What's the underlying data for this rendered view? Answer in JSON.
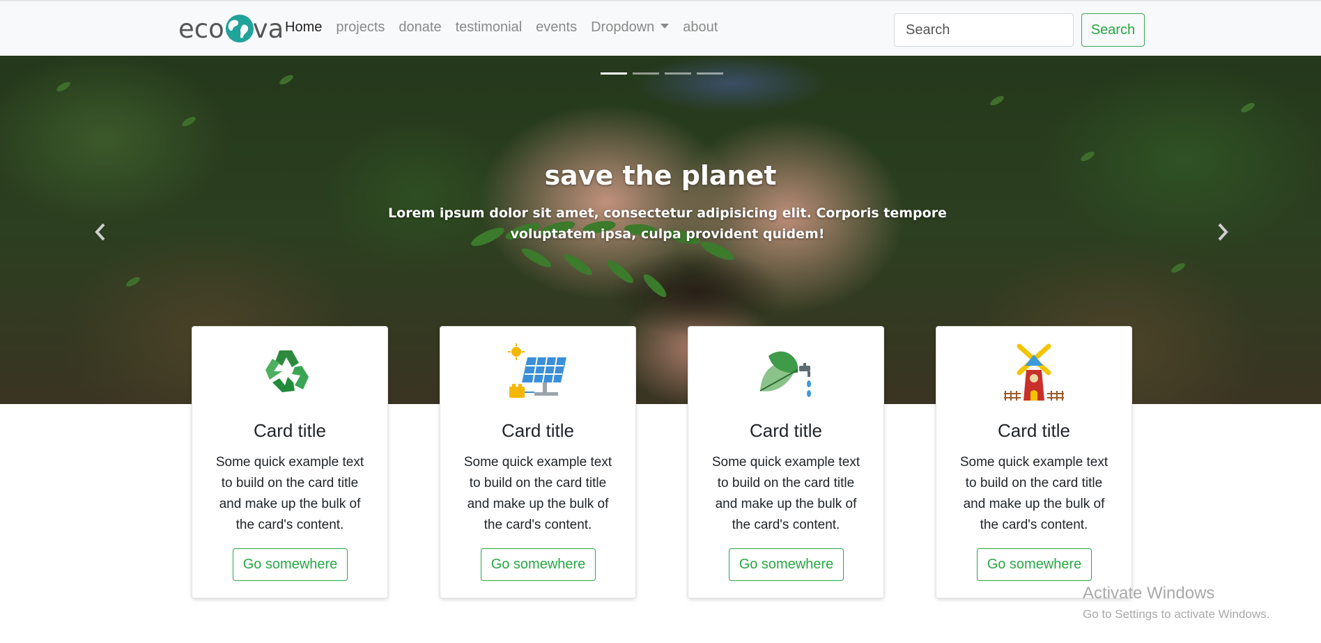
{
  "navbar": {
    "brand": {
      "prefix": "eco",
      "suffix": "va"
    },
    "links": [
      {
        "label": "Home",
        "active": true
      },
      {
        "label": "projects",
        "active": false
      },
      {
        "label": "donate",
        "active": false
      },
      {
        "label": "testimonial",
        "active": false
      },
      {
        "label": "events",
        "active": false
      },
      {
        "label": "Dropdown",
        "active": false
      },
      {
        "label": "about",
        "active": false
      }
    ],
    "search": {
      "placeholder": "Search",
      "button_label": "Search"
    }
  },
  "hero": {
    "title": "save the planet",
    "text": "Lorem ipsum dolor sit amet, consectetur adipisicing elit. Corporis tempore voluptatem ipsa, culpa provident quidem!",
    "indicator_count": 4,
    "active_indicator": 1
  },
  "cards": [
    {
      "icon": "recycle-icon",
      "title": "Card title",
      "text": "Some quick example text to build on the card title and make up the bulk of the card's content.",
      "button_label": "Go somewhere"
    },
    {
      "icon": "solar-panel-icon",
      "title": "Card title",
      "text": "Some quick example text to build on the card title and make up the bulk of the card's content.",
      "button_label": "Go somewhere"
    },
    {
      "icon": "leaf-tap-icon",
      "title": "Card title",
      "text": "Some quick example text to build on the card title and make up the bulk of the card's content.",
      "button_label": "Go somewhere"
    },
    {
      "icon": "windmill-icon",
      "title": "Card title",
      "text": "Some quick example text to build on the card title and make up the bulk of the card's content.",
      "button_label": "Go somewhere"
    }
  ],
  "watermark": {
    "title": "Activate Windows",
    "subtitle": "Go to Settings to activate Windows."
  },
  "colors": {
    "accent": "#28a745",
    "navbar_bg": "#f8f9fa",
    "globe": "#1fa39a"
  }
}
